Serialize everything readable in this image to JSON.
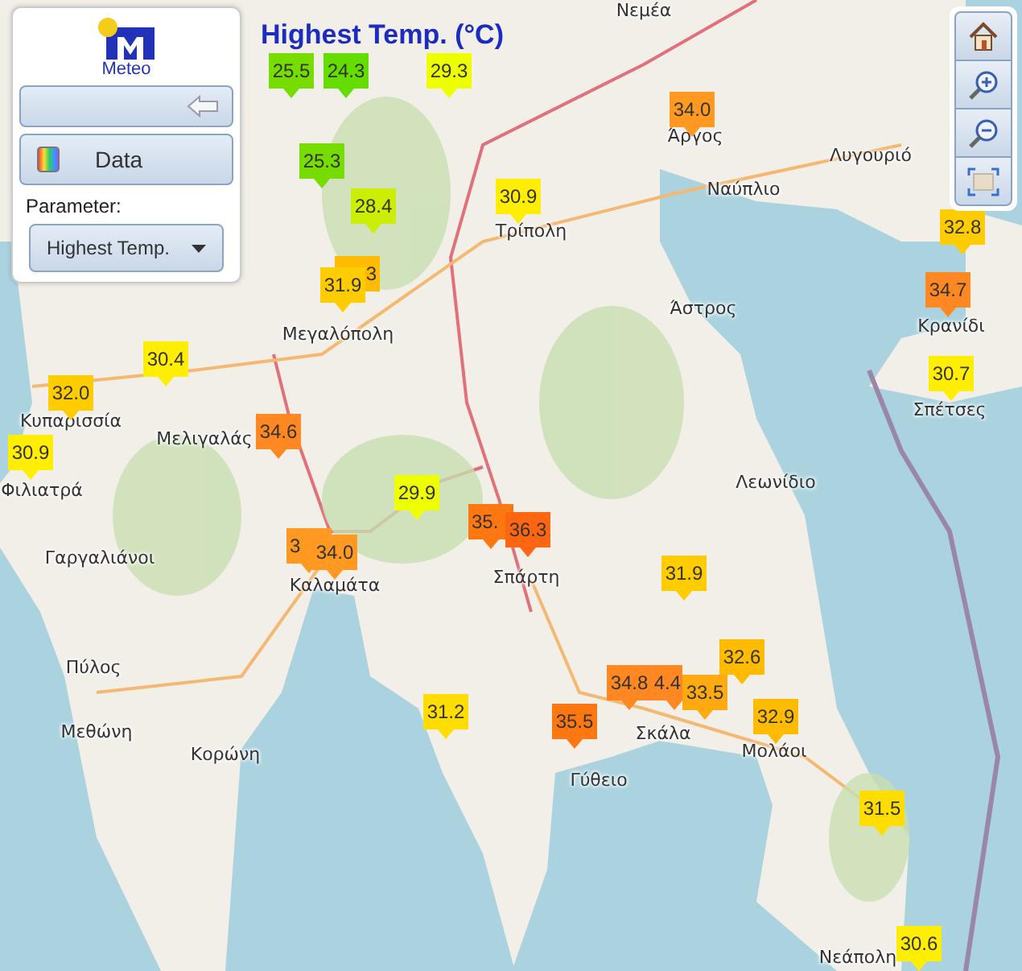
{
  "logo": {
    "text": "Meteo"
  },
  "panel": {
    "data_button": "Data",
    "parameter_label": "Parameter:",
    "parameter_select": "Highest Temp."
  },
  "map_title": "Highest Temp. (°C)",
  "places": [
    "Νεμέα",
    "Τρίπολη",
    "Άργος",
    "Ναύπλιο",
    "Λυγουριό",
    "Άστρος",
    "Κρανίδι",
    "Σπέτσες",
    "Μεγαλόπολη",
    "Κυπαρισσία",
    "Φιλιατρά",
    "Μελιγαλάς",
    "Γαργαλιάνοι",
    "Πύλος",
    "Μεθώνη",
    "Κορώνη",
    "Καλαμάτα",
    "Σπάρτη",
    "Λεωνίδιο",
    "Σκάλα",
    "Γύθειο",
    "Μολάοι",
    "Νεάπολη"
  ],
  "markers": [
    {
      "value": "25.5",
      "color": "#77dd00",
      "kind": "full"
    },
    {
      "value": "24.3",
      "color": "#66dd00",
      "kind": "full"
    },
    {
      "value": "29.3",
      "color": "#eeff00",
      "kind": "full"
    },
    {
      "value": "25.3",
      "color": "#77dd00",
      "kind": "full"
    },
    {
      "value": "28.4",
      "color": "#ccee00",
      "kind": "full"
    },
    {
      "value": "3",
      "color": "#ffbb00",
      "kind": "right-visible"
    },
    {
      "value": "31.9",
      "color": "#ffcc00",
      "kind": "full"
    },
    {
      "value": "30.9",
      "color": "#ffee00",
      "kind": "full"
    },
    {
      "value": "34.0",
      "color": "#ff9922",
      "kind": "full"
    },
    {
      "value": "32.8",
      "color": "#ffcc00",
      "kind": "full"
    },
    {
      "value": "34.7",
      "color": "#ff8822",
      "kind": "full"
    },
    {
      "value": "30.7",
      "color": "#ffee00",
      "kind": "full"
    },
    {
      "value": "30.4",
      "color": "#ffee00",
      "kind": "full"
    },
    {
      "value": "32.0",
      "color": "#ffcc00",
      "kind": "full"
    },
    {
      "value": "30.9",
      "color": "#ffee00",
      "kind": "full"
    },
    {
      "value": "34.6",
      "color": "#ff8822",
      "kind": "full"
    },
    {
      "value": "29.9",
      "color": "#eeff00",
      "kind": "full"
    },
    {
      "value": "3",
      "color": "#ff9922",
      "kind": "left-visible"
    },
    {
      "value": "34.0",
      "color": "#ff9922",
      "kind": "full"
    },
    {
      "value": "35.",
      "color": "#ff7711",
      "kind": "left-visible"
    },
    {
      "value": "36.3",
      "color": "#ff6611",
      "kind": "full"
    },
    {
      "value": "31.9",
      "color": "#ffcc00",
      "kind": "full"
    },
    {
      "value": "32.6",
      "color": "#ffbb00",
      "kind": "full"
    },
    {
      "value": "4.4",
      "color": "#ff8822",
      "kind": "right-visible"
    },
    {
      "value": "34.8",
      "color": "#ff8822",
      "kind": "full"
    },
    {
      "value": "33.5",
      "color": "#ffaa11",
      "kind": "full"
    },
    {
      "value": "31.2",
      "color": "#ffdd00",
      "kind": "full"
    },
    {
      "value": "35.5",
      "color": "#ff7711",
      "kind": "full"
    },
    {
      "value": "32.9",
      "color": "#ffbb00",
      "kind": "full"
    },
    {
      "value": "31.5",
      "color": "#ffdd00",
      "kind": "full"
    },
    {
      "value": "30.6",
      "color": "#ffee00",
      "kind": "full"
    }
  ]
}
